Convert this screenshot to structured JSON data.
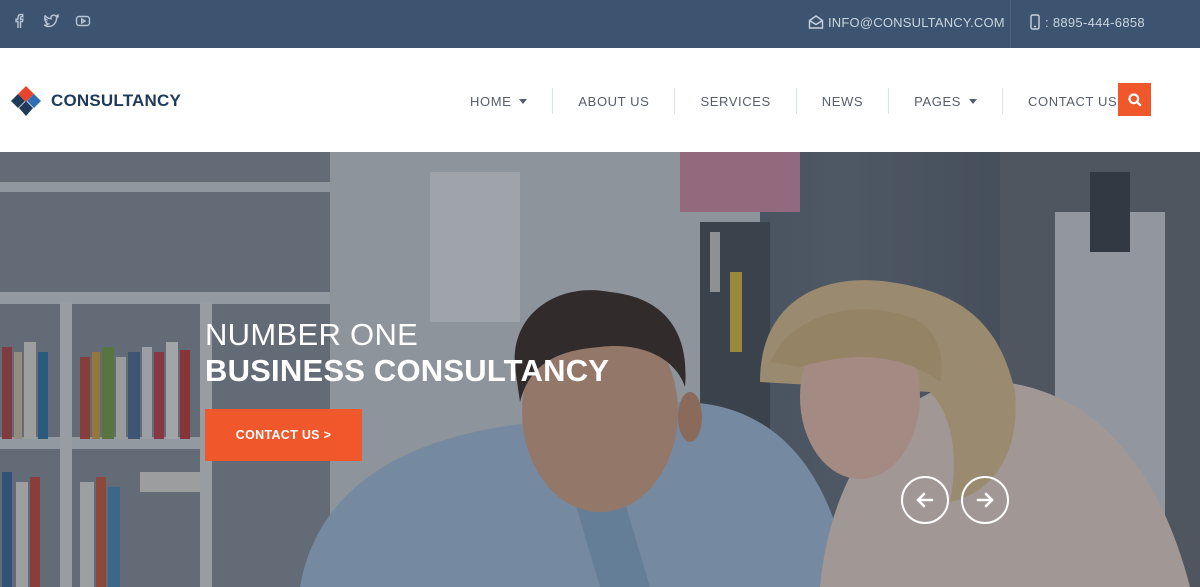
{
  "topbar": {
    "social": [
      {
        "icon": "facebook-icon"
      },
      {
        "icon": "twitter-icon"
      },
      {
        "icon": "youtube-icon"
      }
    ],
    "email": "INFO@CONSULTANCY.COM",
    "phone": ": 8895-444-6858"
  },
  "header": {
    "logo_text": "CONSULTANCY",
    "nav": [
      {
        "label": "HOME",
        "has_dropdown": true
      },
      {
        "label": "ABOUT US",
        "has_dropdown": false
      },
      {
        "label": "SERVICES",
        "has_dropdown": false
      },
      {
        "label": "NEWS",
        "has_dropdown": false
      },
      {
        "label": "PAGES",
        "has_dropdown": true
      },
      {
        "label": "CONTACT US",
        "has_dropdown": false
      }
    ],
    "search_icon": "search-icon"
  },
  "hero": {
    "line1": "NUMBER ONE",
    "line2": "BUSINESS CONSULTANCY",
    "cta_label": "CONTACT US >",
    "prev_icon": "arrow-left-icon",
    "next_icon": "arrow-right-icon"
  },
  "colors": {
    "topbar_bg": "#3d5470",
    "accent": "#f0572a",
    "logo_text": "#1f3a5a",
    "logo_red": "#e8452c",
    "logo_blue": "#2f6fb6",
    "logo_navy": "#1f3a5a"
  }
}
